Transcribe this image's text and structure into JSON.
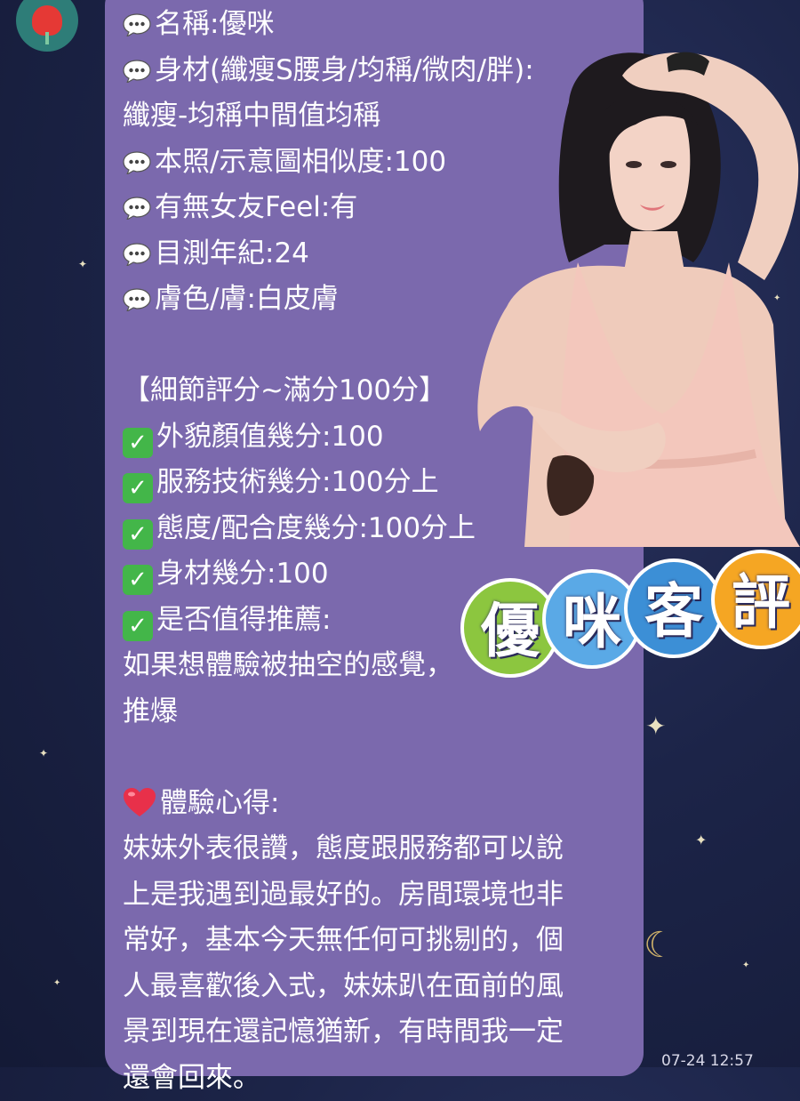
{
  "chat": {
    "sender_avatar_icon": "tulip-icon",
    "timestamp": "07-24 12:57"
  },
  "message": {
    "profile": [
      {
        "icon": "speech-bubble-icon",
        "text": "名稱:優咪"
      },
      {
        "icon": "speech-bubble-icon",
        "text": "身材(纖瘦S腰身/均稱/微肉/胖):"
      },
      {
        "icon": "",
        "text": "纖瘦-均稱中間值均稱"
      },
      {
        "icon": "speech-bubble-icon",
        "text": "本照/示意圖相似度:100"
      },
      {
        "icon": "speech-bubble-icon",
        "text": "有無女友Feel:有"
      },
      {
        "icon": "speech-bubble-icon",
        "text": "目測年紀:24"
      },
      {
        "icon": "speech-bubble-icon",
        "text": "膚色/膚:白皮膚"
      }
    ],
    "rating_header": "【細節評分~滿分100分】",
    "ratings": [
      {
        "icon": "check-mark-icon",
        "text": "外貌顏值幾分:100"
      },
      {
        "icon": "check-mark-icon",
        "text": "服務技術幾分:100分上"
      },
      {
        "icon": "check-mark-icon",
        "text": "態度/配合度幾分:100分上"
      },
      {
        "icon": "check-mark-icon",
        "text": "身材幾分:100"
      },
      {
        "icon": "check-mark-icon",
        "text": "是否值得推薦:"
      }
    ],
    "recommend_lines": [
      "如果想體驗被抽空的感覺，",
      "推爆"
    ],
    "experience_title": "體驗心得:",
    "experience_lines": [
      "妹妹外表很讚，態度跟服務都可以說",
      "上是我遇到過最好的。房間環境也非",
      "常好，基本今天無任何可挑剔的，個",
      "人最喜歡後入式，妹妹趴在面前的風",
      "景到現在還記憶猶新，有時間我一定",
      "還會回來。"
    ]
  },
  "overlay": {
    "badge_chars": [
      "優",
      "咪",
      "客",
      "評"
    ]
  },
  "colors": {
    "bubble": "#7b69ad",
    "background": "#1c2448",
    "check": "#43b649",
    "heart": "#e8304a"
  }
}
